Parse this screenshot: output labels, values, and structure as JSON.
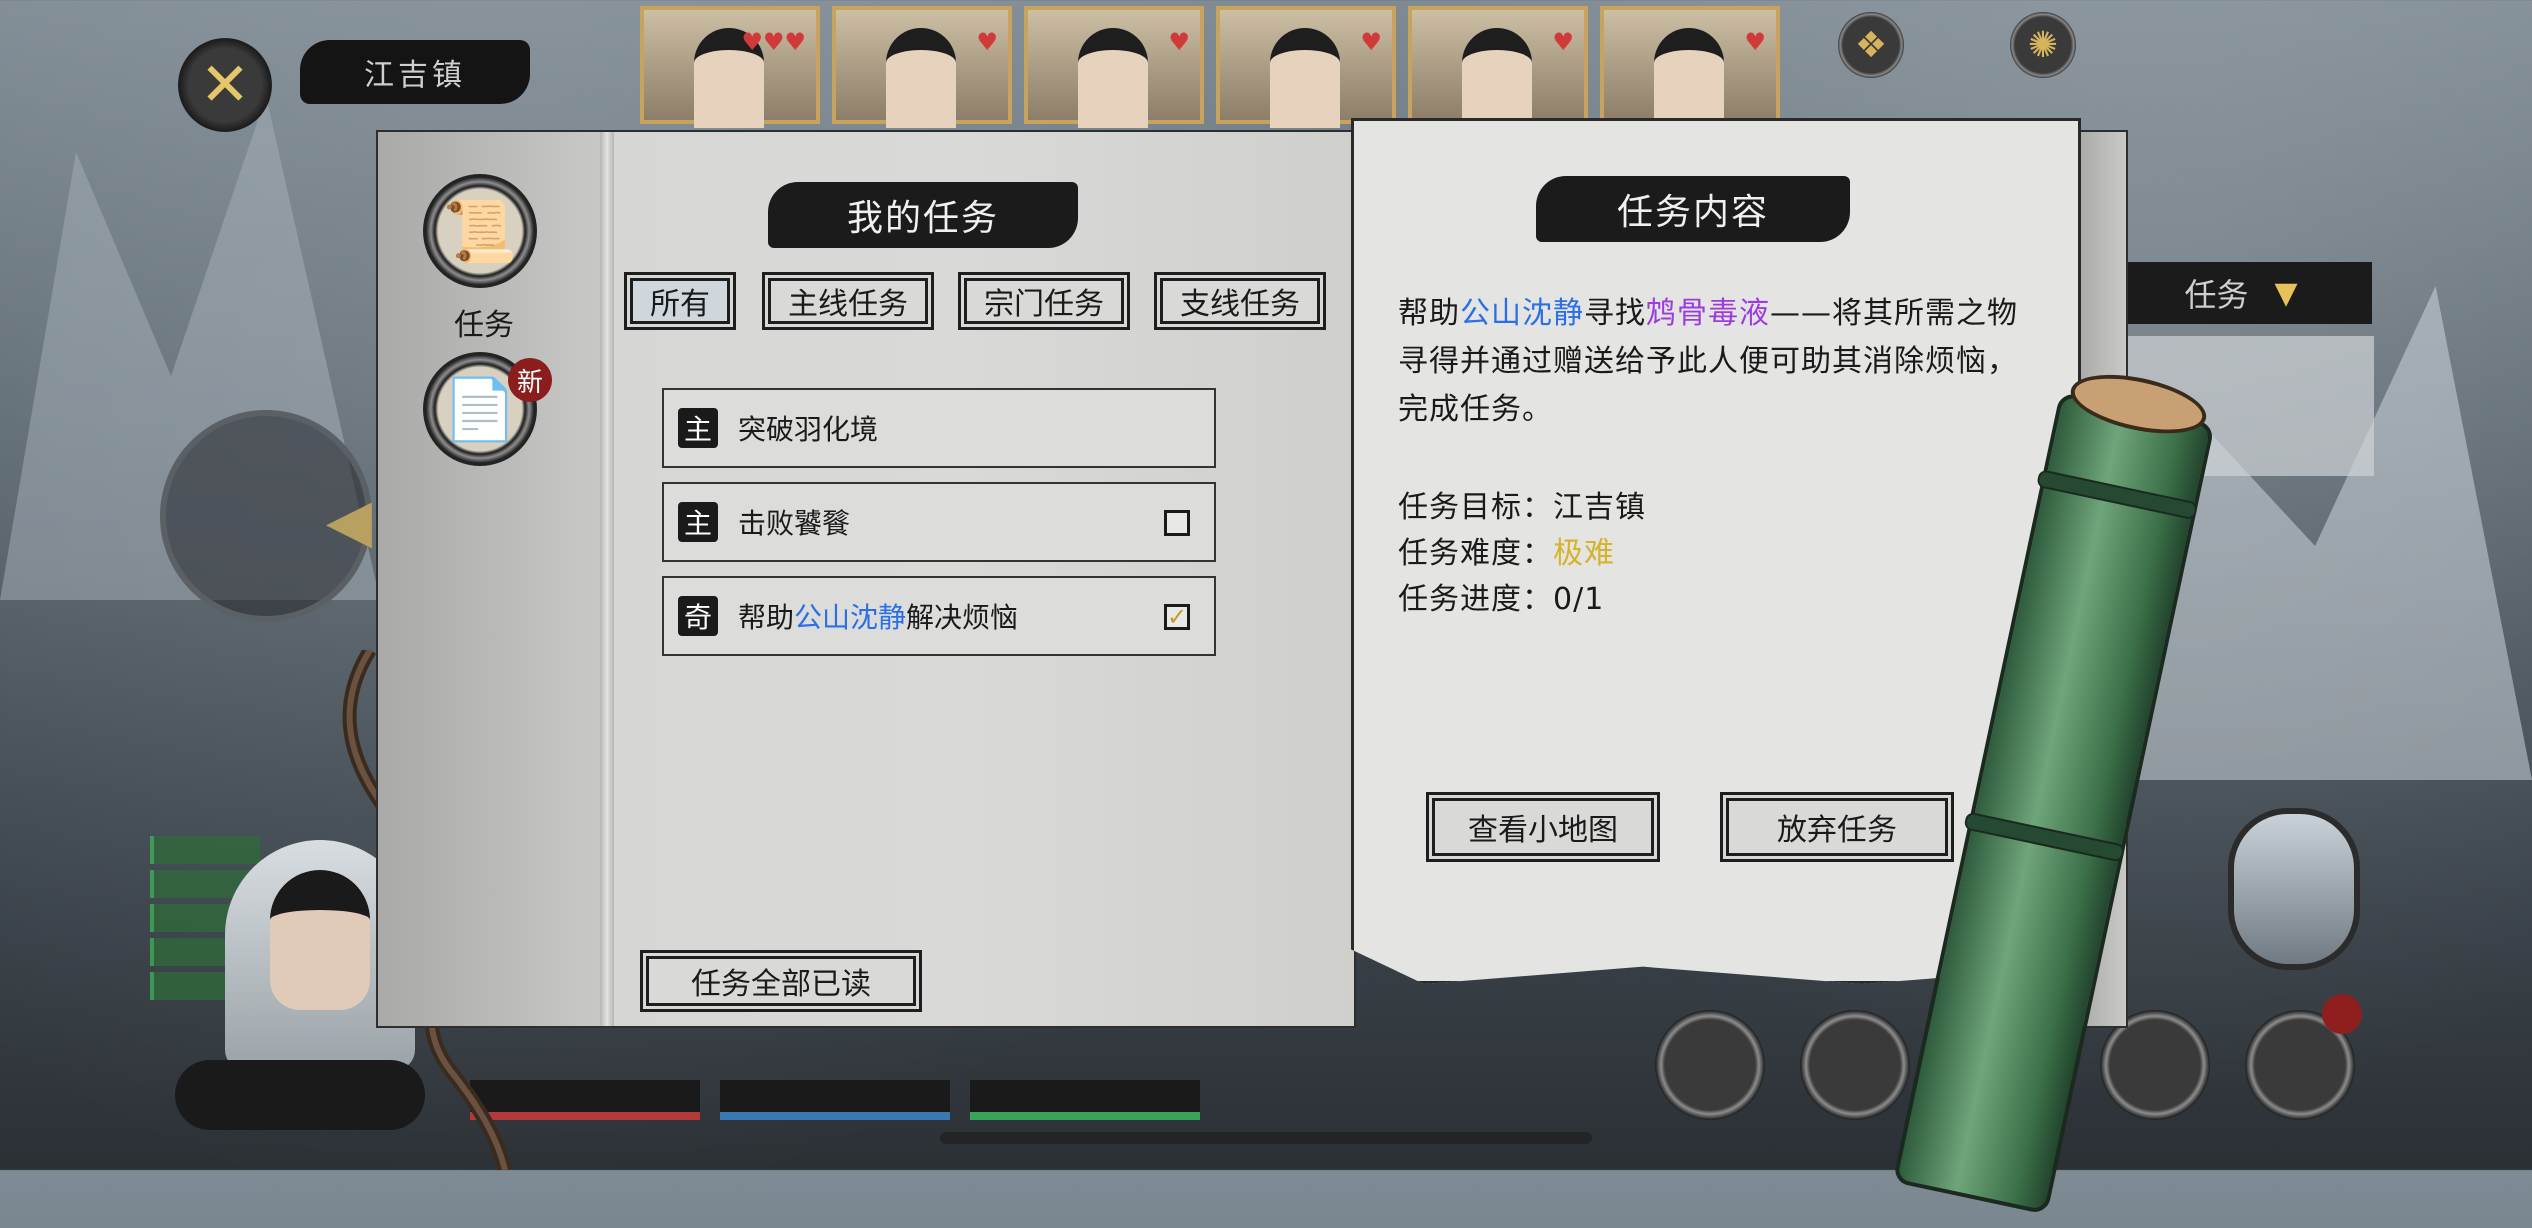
{
  "header": {
    "location": "江吉镇",
    "portraits": [
      {
        "name": "portrait-1",
        "hearts": "♥♥♥"
      },
      {
        "name": "portrait-2",
        "hearts": "♥"
      },
      {
        "name": "portrait-3",
        "hearts": "♥"
      },
      {
        "name": "portrait-4",
        "hearts": "♥"
      },
      {
        "name": "portrait-5",
        "hearts": "♥"
      },
      {
        "name": "portrait-6",
        "hearts": "♥"
      }
    ]
  },
  "side": {
    "tab_label": "任务"
  },
  "left_nav": {
    "quest_label": "任务",
    "new_badge": "新"
  },
  "my_quests": {
    "title": "我的任务",
    "filters": [
      "所有",
      "主线任务",
      "宗门任务",
      "支线任务"
    ],
    "active_filter": 0,
    "quests": [
      {
        "kind": "主",
        "text": "突破羽化境",
        "checkbox": null
      },
      {
        "kind": "主",
        "text": "击败饕餮",
        "checkbox": "unchecked"
      },
      {
        "kind": "奇",
        "prefix": "帮助",
        "highlight": "公山沈静",
        "suffix": "解决烦恼",
        "checkbox": "checked"
      }
    ],
    "read_all_label": "任务全部已读"
  },
  "quest_content": {
    "title": "任务内容",
    "desc_1": "帮助",
    "desc_name": "公山沈静",
    "desc_2": "寻找",
    "desc_item": "鸩骨毒液",
    "desc_3": "——将其所需之物寻得并通过赠送给予此人便可助其消除烦恼，完成任务。",
    "target_label": "任务目标：",
    "target_value": "江吉镇",
    "difficulty_label": "任务难度：",
    "difficulty_value": "极难",
    "progress_label": "任务进度：",
    "progress_value": "0/1",
    "view_map_label": "查看小地图",
    "abandon_label": "放弃任务"
  },
  "colors": {
    "highlight_blue": "#2a6fe8",
    "highlight_purple": "#9b3ce0",
    "difficulty_gold": "#d3b42b",
    "ink": "#1b1b1b",
    "paper": "#d9d9d7"
  },
  "icons": {
    "close": "crossed-swords-icon",
    "quest_nav": "scroll-icon",
    "letters_nav": "letters-icon",
    "settings": "gear-icon"
  }
}
